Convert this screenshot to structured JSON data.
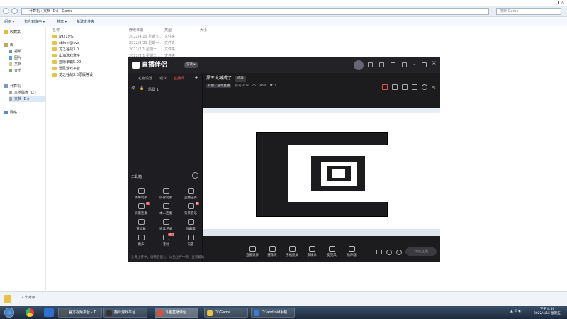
{
  "explorer": {
    "address": "计算机 › 文档 (D:) › Game",
    "search_placeholder": "搜索 Game",
    "toolbar": [
      "组织 ▾",
      "包含到库中 ▾",
      "共享 ▾",
      "新建文件夹"
    ],
    "nav": {
      "favorites": "收藏夹",
      "libraries": "库",
      "lib_items": [
        "视频",
        "图片",
        "文档",
        "音乐"
      ],
      "computer": "计算机",
      "drives": [
        "本地磁盘 (C:)",
        "文档 (D:)"
      ],
      "network": "网络"
    },
    "columns": [
      "名称",
      "修改日期",
      "类型",
      "大小"
    ],
    "files": [
      {
        "name": "a9219%",
        "date": "2022/4/15 星期五...",
        "type": "文件夹"
      },
      {
        "name": "cblnnf@sva",
        "date": "2022/3/21 星期一...",
        "type": "文件夹"
      },
      {
        "name": "龙之谷战3.0",
        "date": "2021/2/1 星期一...",
        "type": "文件夹"
      },
      {
        "name": "山海游戏盒子",
        "date": "2022/3/1 星期二...",
        "type": "文件夹"
      },
      {
        "name": "蓝际争霸5.00",
        "date": "2022/3/1 星期二...",
        "type": "文件夹"
      },
      {
        "name": "遗民游戏平台",
        "date": "2022/3/1 星期二...",
        "type": "文件夹"
      },
      {
        "name": "龙之谷战3.0原版停设",
        "date": "2022/2/1 星期二...",
        "type": "文件夹"
      }
    ],
    "status": "7 个对象"
  },
  "app": {
    "name": "直播伴侣",
    "badge": "游戏 ▾",
    "left_tabs": [
      "礼物设置",
      "观众",
      "直播间"
    ],
    "scene_label": "场景 1",
    "tools_header": "工具箱",
    "tools": [
      {
        "label": "弹幕助手",
        "tag": ""
      },
      {
        "label": "房管助手",
        "tag": ""
      },
      {
        "label": "主播任务",
        "tag": ""
      },
      {
        "label": "玩家连麦",
        "tag": "新"
      },
      {
        "label": "本人连麦",
        "tag": ""
      },
      {
        "label": "背景音乐",
        "tag": "新"
      },
      {
        "label": "道具幕",
        "tag": ""
      },
      {
        "label": "道具记录",
        "tag": ""
      },
      {
        "label": "弹幕库",
        "tag": ""
      },
      {
        "label": "更多",
        "tag": ""
      },
      {
        "label": "活动",
        "tag": "热门"
      },
      {
        "label": "设置",
        "tag": ""
      }
    ],
    "room_title": "黑王太臧成了",
    "edit_label": "修改",
    "category_label": "其他 · 游戏直播",
    "room_id_label": "房号 403",
    "room_id_value": "7673854",
    "likes": "0",
    "bottom_tools": [
      "直播录屏",
      "摄像头",
      "手机投屏",
      "多媒体",
      "麦克风",
      "扬声器"
    ],
    "live_button": "开始直播",
    "status_text": "头像上传中，请稍后当心，以免上传中断 · 查看帮助"
  },
  "taskbar": {
    "tasks": [
      {
        "label": "官方视频平台 - T...",
        "color": "#555555"
      },
      {
        "label": "翻译游戏平台",
        "color": "#333333"
      },
      {
        "label": "斗鱼直播伴侣",
        "color": "#e14b3b"
      },
      {
        "label": "D:\\Game",
        "color": "#e8c14a"
      },
      {
        "label": "D:\\android手机...",
        "color": "#3a7bd5"
      }
    ],
    "clock_time": "下午 4:56",
    "clock_date": "2022/4/15 星期五"
  }
}
